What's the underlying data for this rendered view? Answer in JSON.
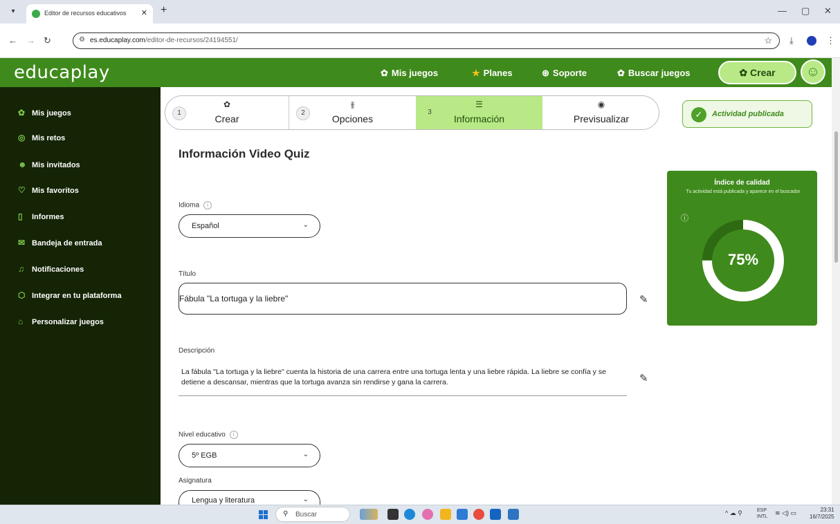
{
  "browser": {
    "tab_title": "Editor de recursos educativos",
    "new_tab": "+",
    "url_host": "es.educaplay.com",
    "url_path": "/editor-de-recursos/24194551/"
  },
  "header": {
    "logo": "educaplay",
    "nav": [
      "Mis juegos",
      "Planes",
      "Soporte",
      "Buscar juegos"
    ],
    "create_label": "Crear"
  },
  "sidebar": {
    "items": [
      {
        "label": "Mis juegos",
        "icon": "puzzle-icon"
      },
      {
        "label": "Mis retos",
        "icon": "target-icon"
      },
      {
        "label": "Mis invitados",
        "icon": "users-icon"
      },
      {
        "label": "Mis favoritos",
        "icon": "heart-icon"
      },
      {
        "label": "Informes",
        "icon": "clipboard-icon"
      },
      {
        "label": "Bandeja de entrada",
        "icon": "mail-icon"
      },
      {
        "label": "Notificaciones",
        "icon": "bell-icon"
      },
      {
        "label": "Integrar en tu plataforma",
        "icon": "cube-icon"
      },
      {
        "label": "Personalizar juegos",
        "icon": "brush-icon"
      }
    ]
  },
  "steps": [
    {
      "num": "1",
      "label": "Crear"
    },
    {
      "num": "2",
      "label": "Opciones"
    },
    {
      "num": "3",
      "label": "Información"
    },
    {
      "num": "",
      "label": "Previsualizar"
    }
  ],
  "status": {
    "published": "Actividad publicada"
  },
  "form": {
    "heading": "Información Video Quiz",
    "idioma_label": "Idioma",
    "idioma_value": "Español",
    "titulo_label": "Título",
    "titulo_value": "Fábula \"La tortuga y la liebre\"",
    "descripcion_label": "Descripción",
    "descripcion_value": "La fábula \"La tortuga y la liebre\" cuenta la historia de una carrera entre una tortuga lenta y una liebre rápida. La liebre se confía y se detiene a descansar, mientras que la tortuga avanza sin rendirse y gana la carrera.",
    "nivel_label": "Nivel educativo",
    "nivel_value": "5º EGB",
    "asignatura_label": "Asignatura",
    "asignatura_value": "Lengua y literatura"
  },
  "quality": {
    "title": "Índice de calidad",
    "subtitle": "Tu actividad está publicada y aparece en el buscador",
    "percent_label": "75%",
    "percent": 75
  },
  "taskbar": {
    "search": "Buscar",
    "lang": "ESP",
    "lang2": "INTL",
    "time": "23:31",
    "date": "16/7/2025"
  },
  "colors": {
    "brand": "#3f8a1c",
    "accent": "#b8e986",
    "sidebar": "#142405"
  }
}
